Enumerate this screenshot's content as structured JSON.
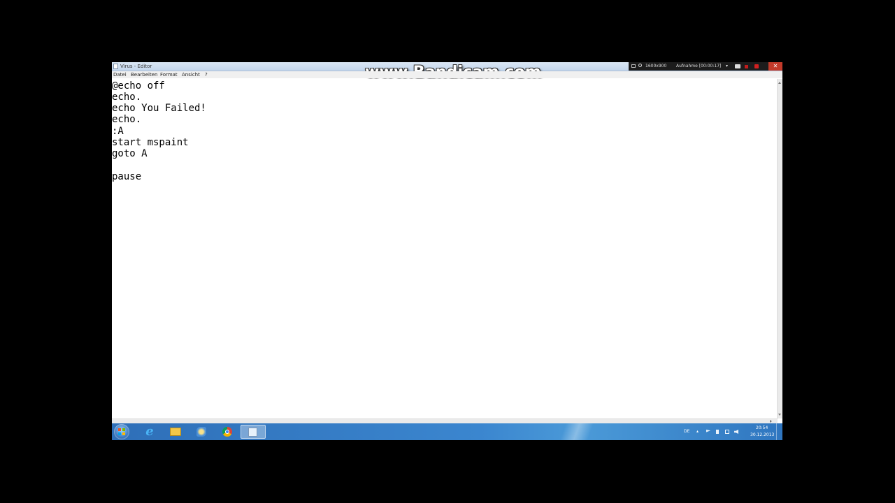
{
  "window": {
    "title": "Virus - Editor"
  },
  "watermark": "www.Bandicam.com",
  "bandicam": {
    "resolution": "1600x900",
    "recording": "Aufnahme [00:00:17]",
    "dropdown": "▾",
    "close": "✕"
  },
  "menu": {
    "items": [
      "Datei",
      "Bearbeiten",
      "Format",
      "Ansicht",
      "?"
    ]
  },
  "editor": {
    "lines": [
      "@echo off",
      "echo.",
      "echo You Failed!",
      "echo.",
      ":A",
      "start mspaint",
      "goto A",
      "",
      "pause"
    ]
  },
  "tray": {
    "language": "DE",
    "arrow": "▴",
    "time": "20:54",
    "date": "30.12.2013"
  },
  "taskbar": {
    "ie_glyph": "e"
  },
  "icons": {
    "start": "windows-logo-icon",
    "pinned": [
      "internet-explorer-icon",
      "file-explorer-icon",
      "paint-icon",
      "chrome-icon",
      "notepad-icon"
    ]
  }
}
